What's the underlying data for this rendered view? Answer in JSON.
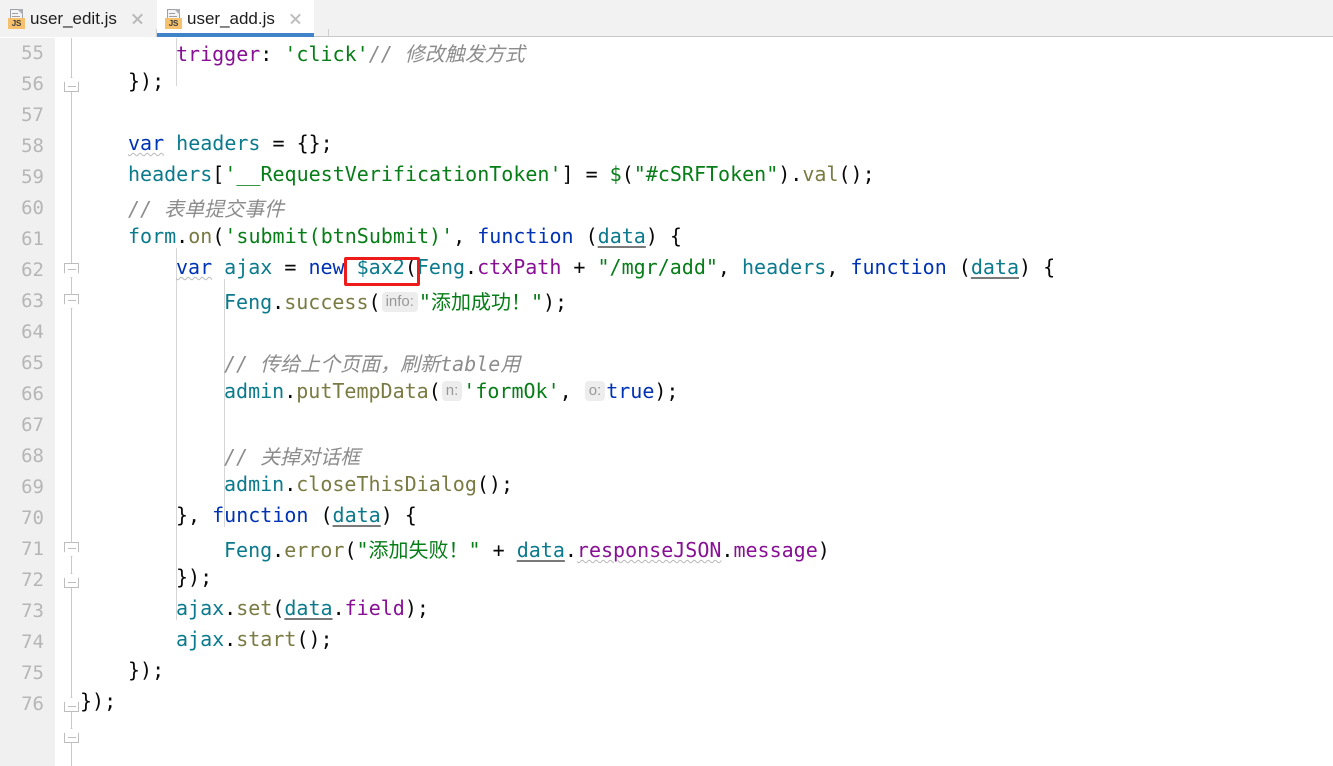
{
  "window": {
    "title": "user_add.js"
  },
  "tabs": [
    {
      "label": "user_edit.js",
      "icon": "js-file-icon",
      "badge": "JS",
      "active": false,
      "close_icon": "close-icon"
    },
    {
      "label": "user_add.js",
      "icon": "js-file-icon",
      "badge": "JS",
      "active": true,
      "close_icon": "close-icon"
    }
  ],
  "colors": {
    "tabbar_bg": "#f2f2f2",
    "tab_active_bg": "#ffffff",
    "tab_active_underline": "#4083c9",
    "gutter_bg": "#f0f0f0",
    "editor_bg": "#ffffff",
    "linenumber": "#b6b6b6",
    "annotation_red": "#ee1b1b",
    "keyword": "#0033b3",
    "string": "#067d17",
    "comment": "#8c8c8c",
    "field": "#871094",
    "method": "#7a7a43",
    "local_var": "#0b7a8c",
    "hint_bg": "#ededed",
    "hint_fg": "#989898",
    "js_badge": "#f5c16c"
  },
  "editor": {
    "first_line": 55,
    "last_line": 76,
    "line_numbers": [
      "55",
      "56",
      "57",
      "58",
      "59",
      "60",
      "61",
      "62",
      "63",
      "64",
      "65",
      "66",
      "67",
      "68",
      "69",
      "70",
      "71",
      "72",
      "73",
      "74",
      "75",
      "76"
    ],
    "lines": [
      {
        "n": "55",
        "text": "        trigger: 'click'// 修改触发方式"
      },
      {
        "n": "56",
        "text": "    });"
      },
      {
        "n": "57",
        "text": ""
      },
      {
        "n": "58",
        "text": "    var headers = {};"
      },
      {
        "n": "59",
        "text": "    headers['__RequestVerificationToken'] = $(\"#cSRFToken\").val();"
      },
      {
        "n": "60",
        "text": "    // 表单提交事件"
      },
      {
        "n": "61",
        "text": "    form.on('submit(btnSubmit)', function (data) {"
      },
      {
        "n": "62",
        "text": "        var ajax = new $ax2(Feng.ctxPath + \"/mgr/add\", headers, function (data) {"
      },
      {
        "n": "63",
        "text": "            Feng.success( info: \"添加成功！\");"
      },
      {
        "n": "64",
        "text": ""
      },
      {
        "n": "65",
        "text": "            // 传给上个页面，刷新table用"
      },
      {
        "n": "66",
        "text": "            admin.putTempData( n: 'formOk',  o: true);"
      },
      {
        "n": "67",
        "text": ""
      },
      {
        "n": "68",
        "text": "            // 关掉对话框"
      },
      {
        "n": "69",
        "text": "            admin.closeThisDialog();"
      },
      {
        "n": "70",
        "text": "        }, function (data) {"
      },
      {
        "n": "71",
        "text": "            Feng.error(\"添加失败！\" + data.responseJSON.message)"
      },
      {
        "n": "72",
        "text": "        });"
      },
      {
        "n": "73",
        "text": "        ajax.set(data.field);"
      },
      {
        "n": "74",
        "text": "        ajax.start();"
      },
      {
        "n": "75",
        "text": "    });"
      },
      {
        "n": "76",
        "text": "});"
      }
    ],
    "parameter_hints": [
      "info:",
      "n:",
      "o:"
    ],
    "fold_markers": [
      {
        "line": "56",
        "type": "collapse-up"
      },
      {
        "line": "61",
        "type": "expand-down"
      },
      {
        "line": "62",
        "type": "expand-down"
      },
      {
        "line": "70",
        "type": "expand-down"
      },
      {
        "line": "72",
        "type": "collapse-up"
      },
      {
        "line": "75",
        "type": "collapse-up"
      },
      {
        "line": "76",
        "type": "collapse-up"
      }
    ]
  },
  "annotation": {
    "type": "red-rectangle-highlight",
    "target_text": "$ax2("
  }
}
